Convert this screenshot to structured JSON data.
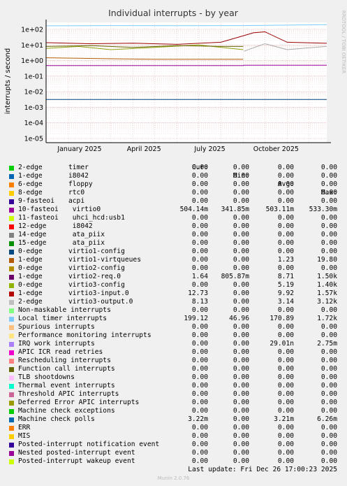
{
  "chart_data": {
    "type": "line",
    "title": "Individual interrupts - by year",
    "ylabel": "interrupts / second",
    "side_label": "RRDTOOL / TOBI OETIKER",
    "y_scale": "log",
    "ylim": [
      1e-05,
      100
    ],
    "y_ticks": [
      "1e+02",
      "1e+01",
      "1e+00",
      "1e-01",
      "1e-02",
      "1e-03",
      "1e-04",
      "1e-05"
    ],
    "x_ticks": [
      "January 2025",
      "April 2025",
      "July 2025",
      "October 2025"
    ],
    "x_tick_dates": [
      "2025-01-01",
      "2025-04-01",
      "2025-07-01",
      "2025-10-01"
    ],
    "x_range": [
      "2024-12-01",
      "2025-12-26"
    ],
    "grid": true,
    "series": [
      {
        "name": "Local timer interrupts",
        "color": "#7ec9f9",
        "x": [
          "2024-12-01",
          "2025-03-01",
          "2025-06-01",
          "2025-09-01",
          "2025-12-26"
        ],
        "y": [
          170,
          175,
          172,
          175,
          199
        ]
      },
      {
        "name": "10-fasteoi virtio0",
        "color": "#990099",
        "x": [
          "2024-12-01",
          "2025-09-01",
          "2025-09-02",
          "2025-12-26"
        ],
        "y": [
          0.48,
          0.48,
          0.504,
          0.504
        ]
      },
      {
        "name": "1-edge virtio3-input.0",
        "color": "#990000",
        "x": [
          "2024-12-01",
          "2025-02-01",
          "2025-04-01",
          "2025-06-01",
          "2025-08-01",
          "2025-09-02",
          "2025-09-15",
          "2025-10-01",
          "2025-11-01",
          "2025-12-26"
        ],
        "y": [
          14,
          12,
          13,
          11,
          15,
          40,
          60,
          70,
          15,
          12.73
        ]
      },
      {
        "name": "0-edge virtio3-config",
        "color": "#8fa00b",
        "x": [
          "2024-12-01",
          "2025-01-15",
          "2025-03-01",
          "2025-05-01",
          "2025-07-01",
          "2025-08-15",
          "2025-09-01"
        ],
        "y": [
          6,
          8,
          5,
          7,
          10,
          6,
          5
        ]
      },
      {
        "name": "1-edge virtio2-req.0",
        "color": "#666600",
        "x": [
          "2024-12-01",
          "2025-02-01",
          "2025-04-01",
          "2025-06-01",
          "2025-08-01",
          "2025-09-01"
        ],
        "y": [
          8,
          9,
          7,
          9,
          8,
          8
        ]
      },
      {
        "name": "2-edge virtio3-output.0",
        "color": "#aaaaaa",
        "x": [
          "2025-09-02",
          "2025-10-01",
          "2025-11-01",
          "2025-12-26"
        ],
        "y": [
          4,
          12,
          5,
          8.13
        ]
      },
      {
        "name": "1-edge virtio1-virtqueues",
        "color": "#b35a00",
        "x": [
          "2024-12-01",
          "2025-03-01",
          "2025-05-01",
          "2025-09-01"
        ],
        "y": [
          1.5,
          1.3,
          1.2,
          1.2
        ]
      },
      {
        "name": "Machine check polls",
        "color": "#00407f",
        "x": [
          "2024-12-01",
          "2025-12-26"
        ],
        "y": [
          0.0032,
          0.0032
        ]
      }
    ],
    "legend_columns": [
      "Cur:",
      "Min:",
      "Avg:",
      "Max:"
    ],
    "legend": [
      {
        "name": "2-edge",
        "sub": "timer",
        "color": "#00cc00",
        "cur": "0.00",
        "min": "0.00",
        "avg": "0.00",
        "max": "0.00"
      },
      {
        "name": "1-edge",
        "sub": "i8042",
        "color": "#0066b3",
        "cur": "0.00",
        "min": "0.00",
        "avg": "0.00",
        "max": "0.00"
      },
      {
        "name": "6-edge",
        "sub": "floppy",
        "color": "#ff8000",
        "cur": "0.00",
        "min": "0.00",
        "avg": "0.00",
        "max": "0.00"
      },
      {
        "name": "8-edge",
        "sub": "rtc0",
        "color": "#ffcc00",
        "cur": "0.00",
        "min": "0.00",
        "avg": "0.00",
        "max": "0.00"
      },
      {
        "name": "9-fasteoi",
        "sub": "acpi",
        "color": "#330099",
        "cur": "0.00",
        "min": "0.00",
        "avg": "0.00",
        "max": "0.00"
      },
      {
        "name": "10-fasteoi",
        "sub": " virtio0",
        "color": "#990099",
        "cur": "504.14m",
        "min": "341.85m",
        "avg": "503.11m",
        "max": "533.30m"
      },
      {
        "name": "11-fasteoi",
        "sub": " uhci_hcd:usb1",
        "color": "#ccff00",
        "cur": "0.00",
        "min": "0.00",
        "avg": "0.00",
        "max": "0.00"
      },
      {
        "name": "12-edge",
        "sub": " i8042",
        "color": "#ff0000",
        "cur": "0.00",
        "min": "0.00",
        "avg": "0.00",
        "max": "0.00"
      },
      {
        "name": "14-edge",
        "sub": " ata_piix",
        "color": "#808080",
        "cur": "0.00",
        "min": "0.00",
        "avg": "0.00",
        "max": "0.00"
      },
      {
        "name": "15-edge",
        "sub": " ata_piix",
        "color": "#008f00",
        "cur": "0.00",
        "min": "0.00",
        "avg": "0.00",
        "max": "0.00"
      },
      {
        "name": "0-edge",
        "sub": "virtio1-config",
        "color": "#00487d",
        "cur": "0.00",
        "min": "0.00",
        "avg": "0.00",
        "max": "0.00"
      },
      {
        "name": "1-edge",
        "sub": "virtio1-virtqueues",
        "color": "#b35a00",
        "cur": "0.00",
        "min": "0.00",
        "avg": "1.23",
        "max": "19.80"
      },
      {
        "name": "0-edge",
        "sub": "virtio2-config",
        "color": "#b38f00",
        "cur": "0.00",
        "min": "0.00",
        "avg": "0.00",
        "max": "0.00"
      },
      {
        "name": "1-edge",
        "sub": "virtio2-req.0",
        "color": "#6b006b",
        "cur": "1.64",
        "min": "805.87m",
        "avg": "8.71",
        "max": "1.50k"
      },
      {
        "name": "0-edge",
        "sub": "virtio3-config",
        "color": "#8fb300",
        "cur": "0.00",
        "min": "0.00",
        "avg": "5.19",
        "max": "1.40k"
      },
      {
        "name": "1-edge",
        "sub": "virtio3-input.0",
        "color": "#b30000",
        "cur": "12.73",
        "min": "0.00",
        "avg": "9.92",
        "max": "1.57k"
      },
      {
        "name": "2-edge",
        "sub": "virtio3-output.0",
        "color": "#bebebe",
        "cur": "8.13",
        "min": "0.00",
        "avg": "3.14",
        "max": "3.12k"
      },
      {
        "name": "Non-maskable interrupts",
        "sub": "",
        "color": "#80ff80",
        "cur": "0.00",
        "min": "0.00",
        "avg": "0.00",
        "max": "0.00"
      },
      {
        "name": "Local timer interrupts",
        "sub": "",
        "color": "#80c9ff",
        "cur": "199.12",
        "min": "46.96",
        "avg": "170.89",
        "max": "1.72k"
      },
      {
        "name": "Spurious interrupts",
        "sub": "",
        "color": "#ffc080",
        "cur": "0.00",
        "min": "0.00",
        "avg": "0.00",
        "max": "0.00"
      },
      {
        "name": "Performance monitoring interrupts",
        "sub": "",
        "color": "#ffe680",
        "cur": "0.00",
        "min": "0.00",
        "avg": "0.00",
        "max": "0.00"
      },
      {
        "name": "IRQ work interrupts",
        "sub": "",
        "color": "#aa80ff",
        "cur": "0.00",
        "min": "0.00",
        "avg": "29.01n",
        "max": "2.75m"
      },
      {
        "name": "APIC ICR read retries",
        "sub": "",
        "color": "#ee00cc",
        "cur": "0.00",
        "min": "0.00",
        "avg": "0.00",
        "max": "0.00"
      },
      {
        "name": "Rescheduling interrupts",
        "sub": "",
        "color": "#ff8080",
        "cur": "0.00",
        "min": "0.00",
        "avg": "0.00",
        "max": "0.00"
      },
      {
        "name": "Function call interrupts",
        "sub": "",
        "color": "#666600",
        "cur": "0.00",
        "min": "0.00",
        "avg": "0.00",
        "max": "0.00"
      },
      {
        "name": "TLB shootdowns",
        "sub": "",
        "color": "#ffbfff",
        "cur": "0.00",
        "min": "0.00",
        "avg": "0.00",
        "max": "0.00"
      },
      {
        "name": "Thermal event interrupts",
        "sub": "",
        "color": "#00ffcc",
        "cur": "0.00",
        "min": "0.00",
        "avg": "0.00",
        "max": "0.00"
      },
      {
        "name": "Threshold APIC interrupts",
        "sub": "",
        "color": "#cc6699",
        "cur": "0.00",
        "min": "0.00",
        "avg": "0.00",
        "max": "0.00"
      },
      {
        "name": "Deferred Error APIC interrupts",
        "sub": "",
        "color": "#999900",
        "cur": "0.00",
        "min": "0.00",
        "avg": "0.00",
        "max": "0.00"
      },
      {
        "name": "Machine check exceptions",
        "sub": "",
        "color": "#00cc00",
        "cur": "0.00",
        "min": "0.00",
        "avg": "0.00",
        "max": "0.00"
      },
      {
        "name": "Machine check polls",
        "sub": "",
        "color": "#0066b3",
        "cur": "3.22m",
        "min": "0.00",
        "avg": "3.21m",
        "max": "6.26m"
      },
      {
        "name": "ERR",
        "sub": "",
        "color": "#ff8000",
        "cur": "0.00",
        "min": "0.00",
        "avg": "0.00",
        "max": "0.00"
      },
      {
        "name": "MIS",
        "sub": "",
        "color": "#ffcc00",
        "cur": "0.00",
        "min": "0.00",
        "avg": "0.00",
        "max": "0.00"
      },
      {
        "name": "Posted-interrupt notification event",
        "sub": "",
        "color": "#330099",
        "cur": "0.00",
        "min": "0.00",
        "avg": "0.00",
        "max": "0.00"
      },
      {
        "name": "Nested posted-interrupt event",
        "sub": "",
        "color": "#990099",
        "cur": "0.00",
        "min": "0.00",
        "avg": "0.00",
        "max": "0.00"
      },
      {
        "name": "Posted-interrupt wakeup event",
        "sub": "",
        "color": "#ccff00",
        "cur": "0.00",
        "min": "0.00",
        "avg": "0.00",
        "max": "0.00"
      }
    ]
  },
  "footer": {
    "last_update": "Last update: Fri Dec 26 17:00:23 2025",
    "version": "Munin 2.0.76"
  }
}
